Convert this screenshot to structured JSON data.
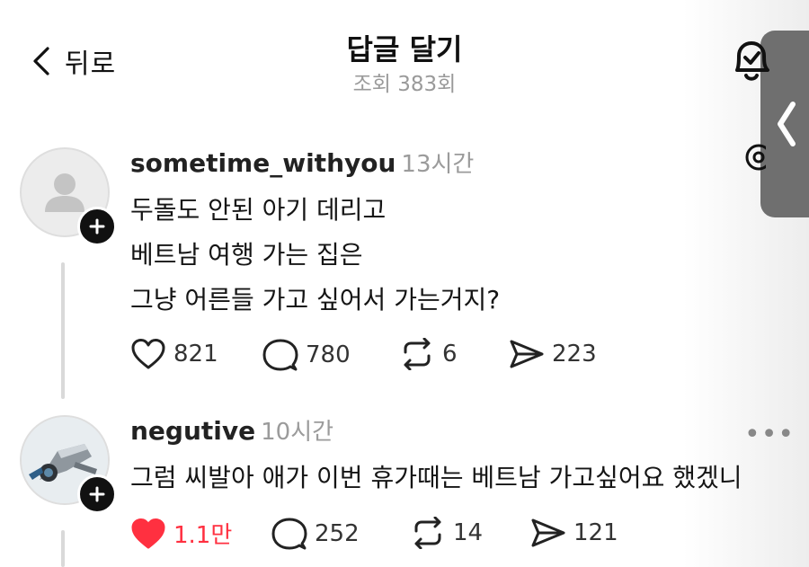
{
  "header": {
    "back_label": "뒤로",
    "title": "답글 달기",
    "views": "조회 383회"
  },
  "posts": [
    {
      "username": "sometime_withyou",
      "time": "13시간",
      "lines": [
        "두돌도 안된 아기 데리고",
        "베트남 여행 가는 집은",
        "그냥 어른들 가고 싶어서 가는거지?"
      ],
      "likes": "821",
      "comments": "780",
      "reposts": "6",
      "shares": "223",
      "liked": false
    },
    {
      "username": "negutive",
      "time": "10시간",
      "lines": [
        "그럼 씨발아 애가 이번 휴가때는 베트남 가고싶어요 했겠니"
      ],
      "likes": "1.1만",
      "comments": "252",
      "reposts": "14",
      "shares": "121",
      "liked": true,
      "more_label": "•••"
    }
  ],
  "colors": {
    "like_active": "#ff3040",
    "handle": "#6f6f6f",
    "muted_text": "#9b9b9b"
  },
  "icons": [
    "chevron-left-icon",
    "bell-check-icon",
    "at-icon",
    "heart-icon",
    "comment-icon",
    "repost-icon",
    "share-icon",
    "plus-icon"
  ]
}
